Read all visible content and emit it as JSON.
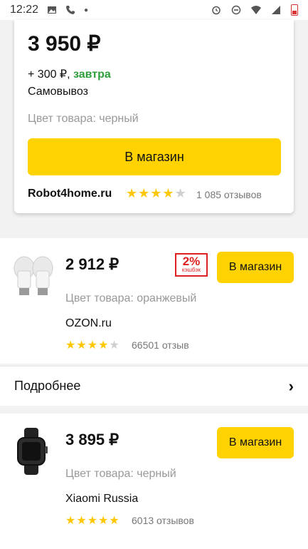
{
  "status_bar": {
    "time": "12:22"
  },
  "top_offer": {
    "price": "3 950 ₽",
    "delivery_cost": "+ 300 ₽, ",
    "delivery_day": "завтра",
    "pickup": "Самовывоз",
    "color": "Цвет товара: черный",
    "button_label": "В магазин",
    "shop": "Robot4home.ru",
    "rating": 4,
    "reviews": "1 085 отзывов"
  },
  "offers": [
    {
      "price": "2 912 ₽",
      "cashback_pct": "2%",
      "cashback_word": "кэшбэк",
      "button_label": "В магазин",
      "color": "Цвет товара: оранжевый",
      "shop": "OZON.ru",
      "rating": 4,
      "reviews": "66501 отзыв",
      "thumb_icon": "bulb-icon"
    },
    {
      "price": "3 895 ₽",
      "button_label": "В магазин",
      "color": "Цвет товара: черный",
      "shop": "Xiaomi Russia",
      "rating": 5,
      "reviews": "6013 отзывов",
      "thumb_icon": "smartwatch-icon"
    }
  ],
  "more_label": "Подробнее",
  "colors": {
    "accent": "#ffd200",
    "green": "#2e9e3c",
    "star": "#ffc700",
    "cashback": "#e02020"
  }
}
